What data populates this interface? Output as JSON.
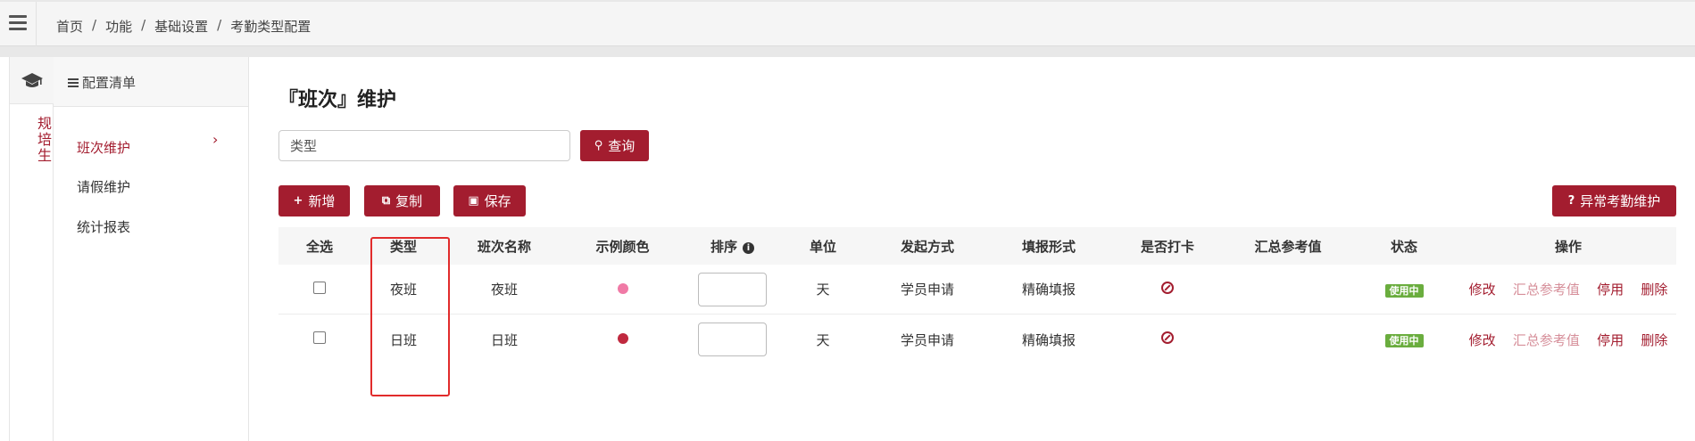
{
  "breadcrumb": [
    "首页",
    "功能",
    "基础设置",
    "考勤类型配置"
  ],
  "sidebar_vertical_tab": "规培生",
  "config_list": {
    "header": "配置清单",
    "items": [
      {
        "label": "班次维护",
        "active": true
      },
      {
        "label": "请假维护",
        "active": false
      },
      {
        "label": "统计报表",
        "active": false
      }
    ]
  },
  "page_title": "『班次』维护",
  "search": {
    "value": "类型",
    "button": "查询"
  },
  "toolbar": {
    "add": "新增",
    "copy": "复制",
    "save": "保存",
    "abnormal": "异常考勤维护"
  },
  "table": {
    "headers": [
      "全选",
      "类型",
      "班次名称",
      "示例颜色",
      "排序",
      "单位",
      "发起方式",
      "填报形式",
      "是否打卡",
      "汇总参考值",
      "状态",
      "操作"
    ],
    "rows": [
      {
        "type": "夜班",
        "name": "夜班",
        "color": "#f07aa6",
        "unit": "天",
        "initiate": "学员申请",
        "fill": "精确填报",
        "status": "使用中",
        "ops": [
          "修改",
          "汇总参考值",
          "停用",
          "删除"
        ]
      },
      {
        "type": "日班",
        "name": "日班",
        "color": "#c0293f",
        "unit": "天",
        "initiate": "学员申请",
        "fill": "精确填报",
        "status": "使用中",
        "ops": [
          "修改",
          "汇总参考值",
          "停用",
          "删除"
        ]
      }
    ]
  },
  "colors": {
    "accent": "#a31d2f",
    "badge": "#6aad3e",
    "highlight_box": "#e12b2b"
  }
}
